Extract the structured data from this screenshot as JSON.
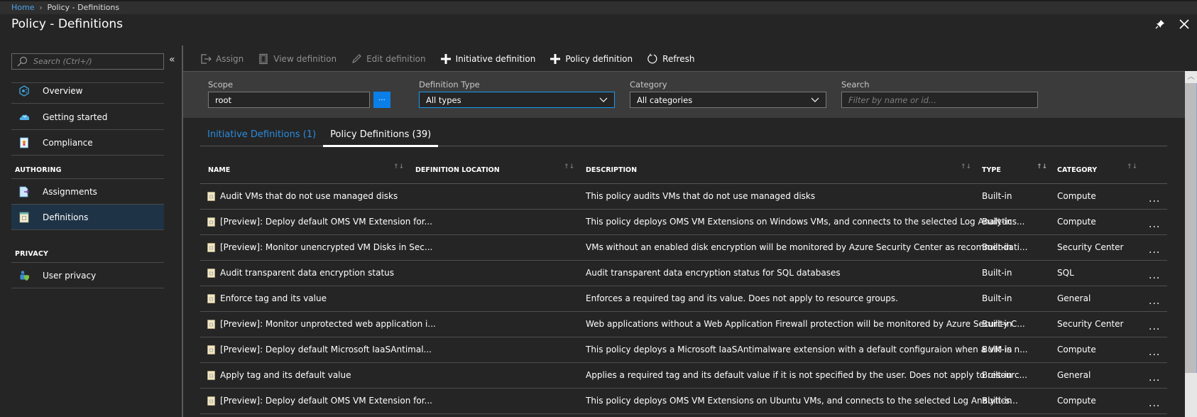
{
  "breadcrumb": {
    "home": "Home",
    "current": "Policy - Definitions"
  },
  "page": {
    "title": "Policy - Definitions"
  },
  "window_icons": [
    "pin-icon",
    "close-icon"
  ],
  "sidebar": {
    "search_placeholder": "Search (Ctrl+/)",
    "collapse_glyph": "«",
    "items": [
      {
        "label": "Overview",
        "icon": "overview-icon"
      },
      {
        "label": "Getting started",
        "icon": "cloud-icon"
      },
      {
        "label": "Compliance",
        "icon": "compliance-icon"
      }
    ],
    "sections": [
      {
        "heading": "AUTHORING",
        "items": [
          {
            "label": "Assignments",
            "icon": "assignments-icon"
          },
          {
            "label": "Definitions",
            "icon": "definitions-icon",
            "active": true
          }
        ]
      },
      {
        "heading": "PRIVACY",
        "items": [
          {
            "label": "User privacy",
            "icon": "user-privacy-icon"
          }
        ]
      }
    ]
  },
  "toolbar": {
    "assign": "Assign",
    "view_definition": "View definition",
    "edit_definition": "Edit definition",
    "initiative_definition": "Initiative definition",
    "policy_definition": "Policy definition",
    "refresh": "Refresh"
  },
  "filters": {
    "scope": {
      "label": "Scope",
      "value": "root",
      "button": "..."
    },
    "definition_type": {
      "label": "Definition Type",
      "value": "All types"
    },
    "category": {
      "label": "Category",
      "value": "All categories"
    },
    "search": {
      "label": "Search",
      "placeholder": "Filter by name or id..."
    }
  },
  "tabs": [
    {
      "label": "Initiative Definitions (1)",
      "active": false
    },
    {
      "label": "Policy Definitions (39)",
      "active": true
    }
  ],
  "table": {
    "columns": [
      "NAME",
      "DEFINITION LOCATION",
      "DESCRIPTION",
      "TYPE",
      "CATEGORY"
    ],
    "rows": [
      {
        "name": "Audit VMs that do not use managed disks",
        "location": "",
        "description": "This policy audits VMs that do not use managed disks",
        "type": "Built-in",
        "category": "Compute"
      },
      {
        "name": "[Preview]: Deploy default OMS VM Extension for...",
        "location": "",
        "description": "This policy deploys OMS VM Extensions on Windows VMs, and connects to the selected Log Analytics...",
        "type": "Built-in",
        "category": "Compute"
      },
      {
        "name": "[Preview]: Monitor unencrypted VM Disks in Sec...",
        "location": "",
        "description": "VMs without an enabled disk encryption will be monitored by Azure Security Center as recommendati...",
        "type": "Built-in",
        "category": "Security Center"
      },
      {
        "name": "Audit transparent data encryption status",
        "location": "",
        "description": "Audit transparent data encryption status for SQL databases",
        "type": "Built-in",
        "category": "SQL"
      },
      {
        "name": "Enforce tag and its value",
        "location": "",
        "description": "Enforces a required tag and its value. Does not apply to resource groups.",
        "type": "Built-in",
        "category": "General"
      },
      {
        "name": "[Preview]: Monitor unprotected web application i...",
        "location": "",
        "description": "Web applications without a Web Application Firewall protection will be monitored by Azure Security C...",
        "type": "Built-in",
        "category": "Security Center"
      },
      {
        "name": "[Preview]: Deploy default Microsoft IaaSAntimal...",
        "location": "",
        "description": "This policy deploys a Microsoft IaaSAntimalware extension with a default configuraion when a VM is n...",
        "type": "Built-in",
        "category": "Compute"
      },
      {
        "name": "Apply tag and its default value",
        "location": "",
        "description": "Applies a required tag and its default value if it is not specified by the user. Does not apply to resourc...",
        "type": "Built-in",
        "category": "General"
      },
      {
        "name": "[Preview]: Deploy default OMS VM Extension for...",
        "location": "",
        "description": "This policy deploys OMS VM Extensions on Ubuntu VMs, and connects to the selected Log Analytics...",
        "type": "Built-in",
        "category": "Compute"
      }
    ],
    "row_action": "..."
  },
  "colors": {
    "accent": "#0a7fe8",
    "link": "#2a8ce0",
    "active_nav": "#1f3346",
    "background": "#252525",
    "filter_panel": "#3b3b3b"
  }
}
